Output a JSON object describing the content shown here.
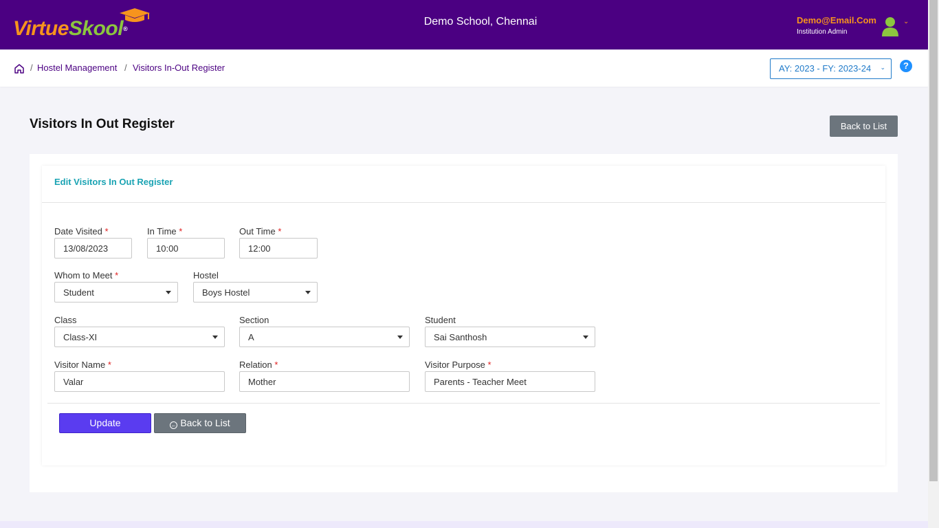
{
  "header": {
    "logo_part1": "Virtue",
    "logo_part2": "Skool",
    "logo_reg": "®",
    "school_name": "Demo School, Chennai",
    "user_email": "Demo@Email.Com",
    "user_role": "Institution Admin",
    "brand_color": "#4b0082"
  },
  "breadcrumb": {
    "items": [
      "Hostel Management",
      "Visitors In-Out Register"
    ],
    "separator": "/"
  },
  "academic_year": {
    "value": "AY: 2023 - FY: 2023-24",
    "caret": "⌄"
  },
  "help": {
    "glyph": "?"
  },
  "page": {
    "title": "Visitors In Out Register",
    "back_top_label": "Back to List"
  },
  "form": {
    "heading": "Edit Visitors In Out Register",
    "required_mark": "*",
    "date_visited": {
      "label": "Date Visited",
      "value": "13/08/2023"
    },
    "in_time": {
      "label": "In Time",
      "value": "10:00"
    },
    "out_time": {
      "label": "Out Time",
      "value": "12:00"
    },
    "whom_to_meet": {
      "label": "Whom to Meet",
      "value": "Student"
    },
    "hostel": {
      "label": "Hostel",
      "value": "Boys Hostel"
    },
    "class": {
      "label": "Class",
      "value": "Class-XI"
    },
    "section": {
      "label": "Section",
      "value": "A"
    },
    "student": {
      "label": "Student",
      "value": "Sai Santhosh"
    },
    "visitor_name": {
      "label": "Visitor Name",
      "value": "Valar"
    },
    "relation": {
      "label": "Relation",
      "value": "Mother"
    },
    "visitor_purpose": {
      "label": "Visitor Purpose",
      "value": "Parents - Teacher Meet"
    },
    "update_label": "Update",
    "back_label": "Back to List",
    "back_icon": "←"
  }
}
